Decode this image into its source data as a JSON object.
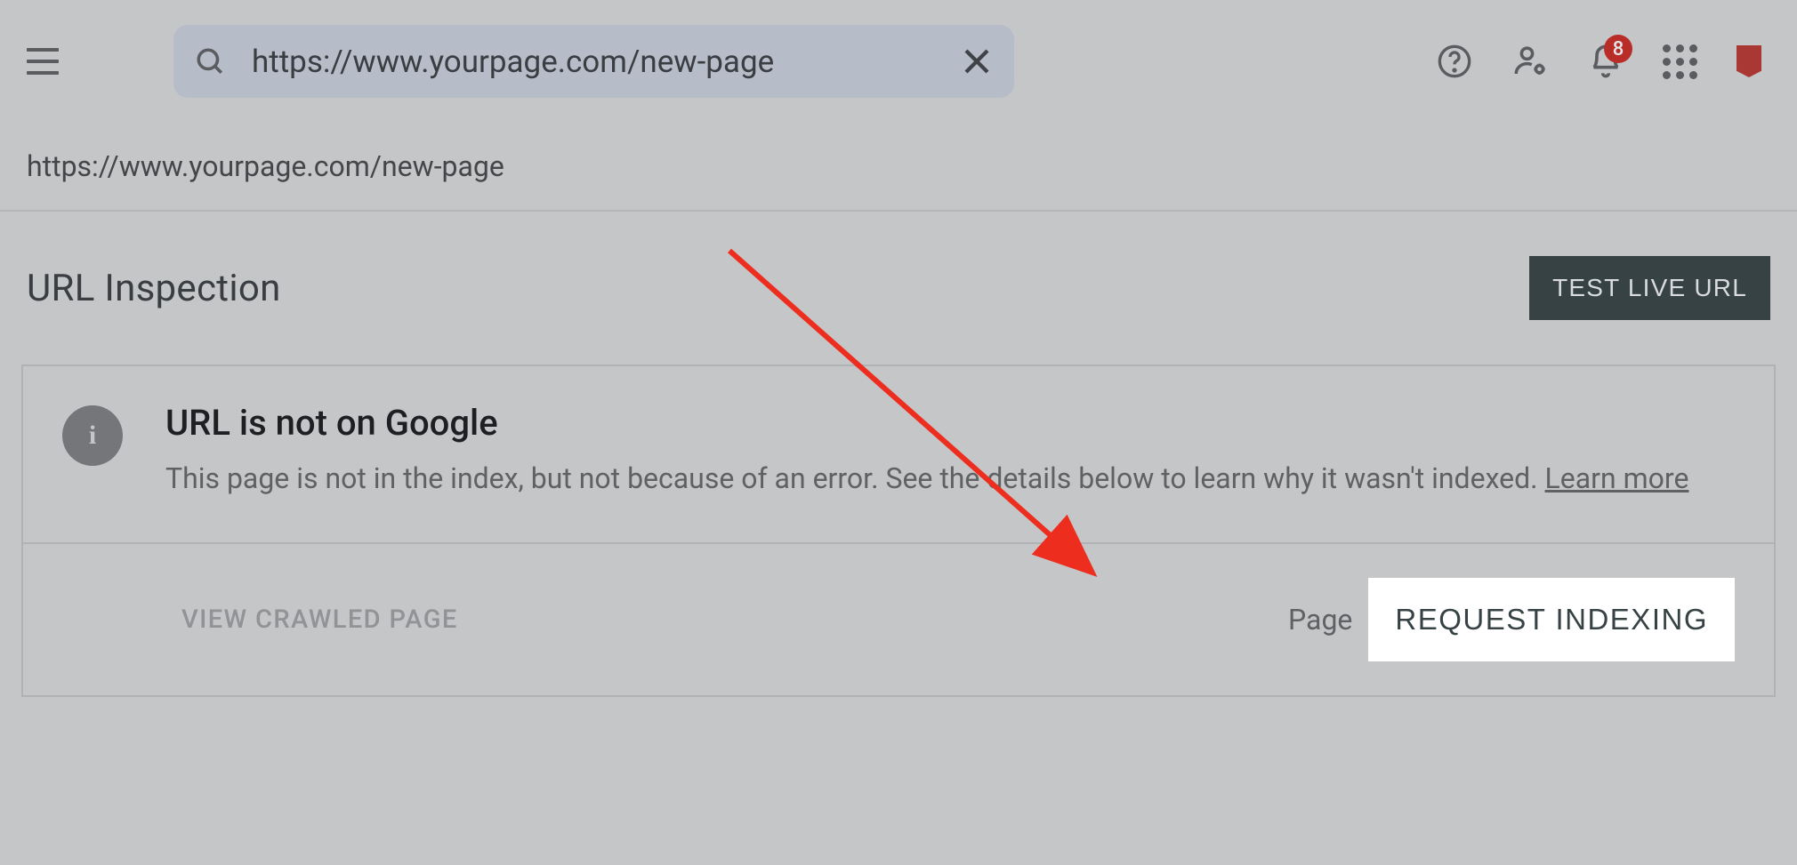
{
  "header": {
    "search_value": "https://www.yourpage.com/new-page",
    "notification_count": "8"
  },
  "url_display": "https://www.yourpage.com/new-page",
  "section": {
    "title": "URL Inspection",
    "test_button": "TEST LIVE URL"
  },
  "card": {
    "heading": "URL is not on Google",
    "description_part1": "This page is not in the index, but not because of an error. See the details below to learn why it wasn't indexed. ",
    "learn_more": "Learn more",
    "view_crawled": "VIEW CRAWLED PAGE",
    "page_label": "Page",
    "request_indexing": "REQUEST INDEXING"
  }
}
